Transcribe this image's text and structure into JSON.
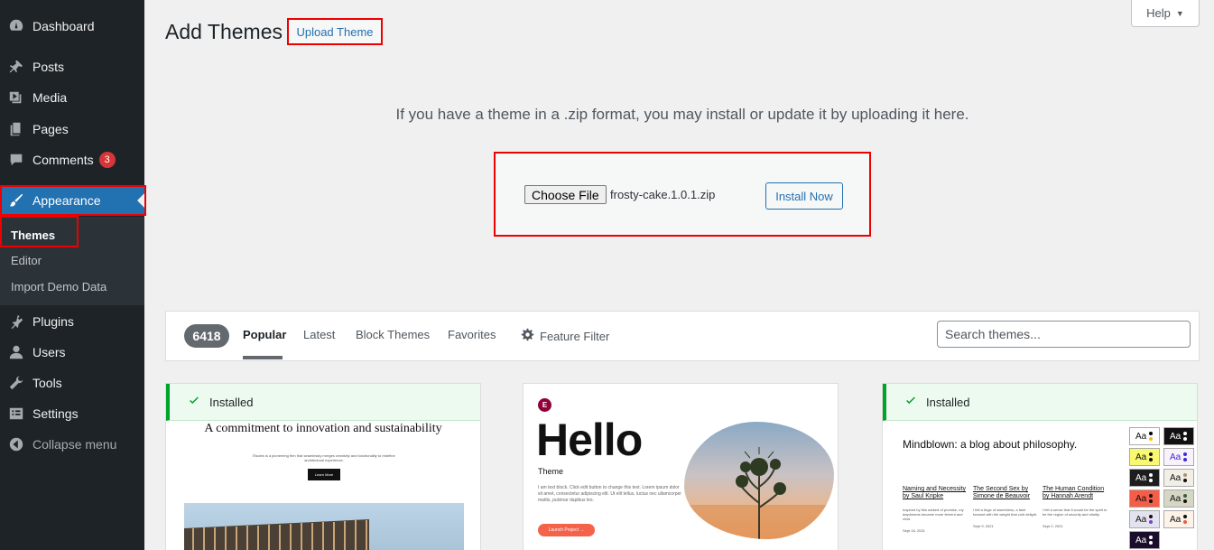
{
  "sidebar": {
    "items": [
      {
        "label": "Dashboard",
        "icon": "dashboard-icon"
      },
      {
        "label": "Posts",
        "icon": "pin-icon"
      },
      {
        "label": "Media",
        "icon": "media-icon"
      },
      {
        "label": "Pages",
        "icon": "pages-icon"
      },
      {
        "label": "Comments",
        "icon": "comment-icon",
        "badge": "3"
      },
      {
        "label": "Appearance",
        "icon": "paintbrush-icon",
        "active": true
      },
      {
        "label": "Plugins",
        "icon": "plugin-icon"
      },
      {
        "label": "Users",
        "icon": "users-icon"
      },
      {
        "label": "Tools",
        "icon": "wrench-icon"
      },
      {
        "label": "Settings",
        "icon": "settings-icon"
      },
      {
        "label": "Collapse menu",
        "icon": "collapse-icon"
      }
    ],
    "submenu": [
      {
        "label": "Themes",
        "current": true
      },
      {
        "label": "Editor"
      },
      {
        "label": "Import Demo Data"
      }
    ]
  },
  "header": {
    "title": "Add Themes",
    "upload_label": "Upload Theme",
    "help_label": "Help"
  },
  "upload": {
    "description": "If you have a theme in a .zip format, you may install or update it by uploading it here.",
    "choose_file_label": "Choose File",
    "file_name": "frosty-cake.1.0.1.zip",
    "install_label": "Install Now"
  },
  "filter": {
    "count": "6418",
    "tabs": [
      "Popular",
      "Latest",
      "Block Themes",
      "Favorites"
    ],
    "current_tab": "Popular",
    "feature_filter_label": "Feature Filter",
    "search_placeholder": "Search themes..."
  },
  "themes": {
    "card1": {
      "installed_label": "Installed",
      "headline": "A commitment to innovation and sustainability",
      "tagline": "Études is a pioneering firm that seamlessly merges creativity and functionality to redefine architectural experience.",
      "button": "Learn More"
    },
    "card2": {
      "logo": "E",
      "title": "Hello",
      "subtitle": "Theme",
      "body": "I am text block. Click edit button to change this text. Lorem ipsum dolor sit amet, consectetur adipiscing elit. Ut elit tellus, luctus nec ullamcorper mattis, pulvinar dapibus leo.",
      "cta": "Launch Project →"
    },
    "card3": {
      "installed_label": "Installed",
      "headline": "Mindblown: a blog about philosophy.",
      "posts": [
        {
          "title": "Naming and Necessity by Saul Kripke",
          "body": "Inspired by this wicked of promise, my daydreams became more fervent and vivid.",
          "date": "Sept 16, 2021"
        },
        {
          "title": "The Second Sex by Simone de Beauvoir",
          "body": "I felt a tinge of sweetness, a faint forward with the weight that cold delight.",
          "date": "Sept 9, 2021"
        },
        {
          "title": "The Human Condition by Hannah Arendt",
          "body": "I felt a sense that it would be the spirit to be the region of security and vitality.",
          "date": "Sept 2, 2021"
        }
      ],
      "swatch_label": "Aa",
      "swatches": [
        {
          "bg": "#ffffff",
          "fg": "#111111",
          "d1": "#000000",
          "d2": "#f0c000"
        },
        {
          "bg": "#111111",
          "fg": "#ffffff",
          "d1": "#ffffff",
          "d2": "#ffffff"
        },
        {
          "bg": "#f9f871",
          "fg": "#111111",
          "d1": "#111111",
          "d2": "#111111"
        },
        {
          "bg": "#f7f2fb",
          "fg": "#3d2ad6",
          "d1": "#3d2ad6",
          "d2": "#3d2ad6"
        },
        {
          "bg": "#1d1d1d",
          "fg": "#ffffff",
          "d1": "#ffffff",
          "d2": "#ffffff"
        },
        {
          "bg": "#f2efe7",
          "fg": "#111111",
          "d1": "#b0906a",
          "d2": "#111111"
        },
        {
          "bg": "#f45d48",
          "fg": "#111111",
          "d1": "#111111",
          "d2": "#111111"
        },
        {
          "bg": "#d6d6c5",
          "fg": "#111111",
          "d1": "#3b5b3b",
          "d2": "#111111"
        },
        {
          "bg": "#e3e3f0",
          "fg": "#111111",
          "d1": "#111111",
          "d2": "#7d3dd6"
        },
        {
          "bg": "#fdf3e8",
          "fg": "#111111",
          "d1": "#111111",
          "d2": "#e85d45"
        },
        {
          "bg": "#1b0e2b",
          "fg": "#ffffff",
          "d1": "#ffffff",
          "d2": "#ffffff"
        }
      ]
    }
  },
  "colors": {
    "sidebar_bg": "#1d2327",
    "accent": "#2271b1",
    "highlight_box": "#e00000",
    "installed_green": "#00a32a"
  }
}
